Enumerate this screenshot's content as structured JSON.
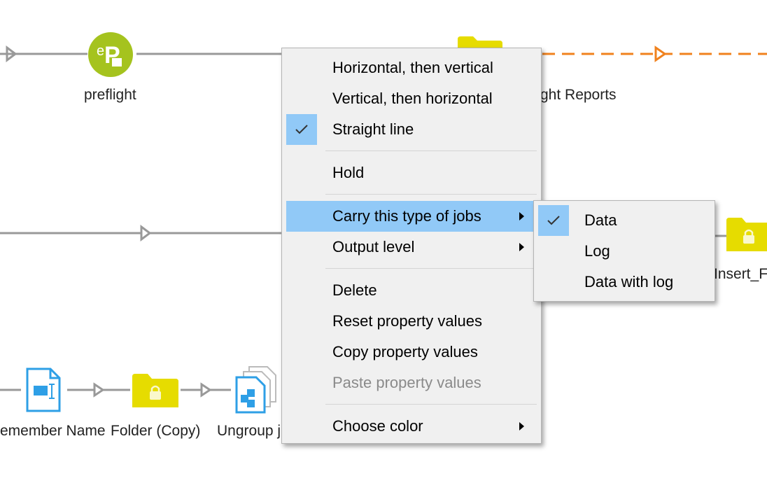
{
  "canvas": {
    "nodes": {
      "preflight": "preflight",
      "preflight_reports": "ght Reports",
      "insert": "Insert_F",
      "remember_name": "emember Name",
      "folder_copy": "Folder (Copy)",
      "ungroup": "Ungroup j"
    },
    "colors": {
      "connection": "#999999",
      "selected_connection": "#f0821e",
      "folder": "#e6dc00",
      "preflight_icon": "#a5c31e",
      "file_icon": "#2e9fe6"
    }
  },
  "context_menu": {
    "items": [
      {
        "label": "Horizontal, then vertical"
      },
      {
        "label": "Vertical, then horizontal"
      },
      {
        "label": "Straight line",
        "checked": true
      },
      {
        "label": "Hold"
      },
      {
        "label": "Carry this type of jobs",
        "submenu": true,
        "highlighted": true
      },
      {
        "label": "Output level",
        "submenu": true
      },
      {
        "label": "Delete"
      },
      {
        "label": "Reset property values"
      },
      {
        "label": "Copy property values"
      },
      {
        "label": "Paste property values",
        "disabled": true
      },
      {
        "label": "Choose color",
        "submenu": true
      }
    ],
    "highlight_color": "#91c9f7"
  },
  "submenu": {
    "items": [
      {
        "label": "Data",
        "checked": true
      },
      {
        "label": "Log"
      },
      {
        "label": "Data with log"
      }
    ]
  }
}
